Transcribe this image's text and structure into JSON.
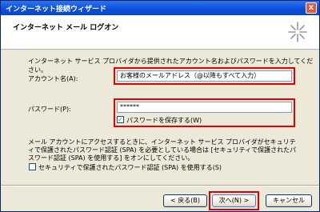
{
  "window": {
    "title": "インターネット接続ウィザード",
    "close_label": "x"
  },
  "header": {
    "title": "インターネット メール ログオン",
    "icon": "sparkle-icon"
  },
  "description": "インターネット サービス プロバイダから提供されたアカウント名およびパスワードを入力してください。",
  "account": {
    "label": "アカウント名(A):",
    "value": "お客様のメールアドレス（@以降もすべて入力）"
  },
  "password": {
    "label": "パスワード(P):",
    "value": "******",
    "save_label": "パスワードを保存する(W)",
    "save_checked": true
  },
  "spa": {
    "text": "メール アカウントにアクセスするときに、インターネット サービス プロバイダがセキュリティで保護されたパスワード認証 (SPA) を必要としている場合は [セキュリティで保護されたパスワード認証 (SPA) を使用する] をオンにしてください。",
    "checkbox_label": "セキュリティで保護されたパスワード認証 (SPA) を使用する(S)",
    "checked": false
  },
  "buttons": {
    "back": "< 戻る(B)",
    "next": "次へ(N) >",
    "cancel": "キャンセル"
  },
  "highlight_color": "#e30000"
}
